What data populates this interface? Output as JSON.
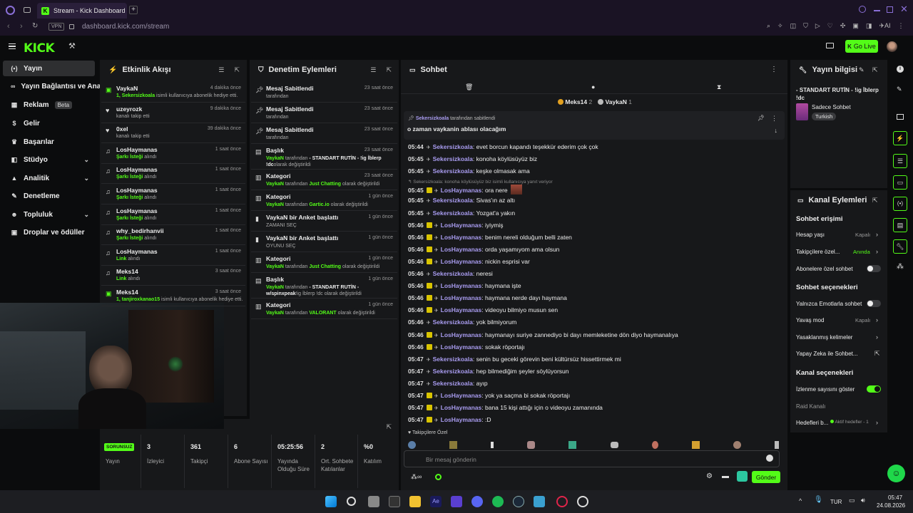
{
  "browser": {
    "tab_title": "Stream - Kick Dashboard",
    "vpn_label": "VPN",
    "url": "dashboard.kick.com/stream",
    "ai_label": "AI"
  },
  "header": {
    "logo": "KICK",
    "go_live": "Go Live"
  },
  "sidebar": {
    "items": [
      {
        "label": "Yayın",
        "icon": "broadcast-icon"
      },
      {
        "label": "Yayın Bağlantısı ve Anahtarı",
        "icon": "link-icon"
      },
      {
        "label": "Reklam",
        "icon": "ad-icon",
        "badge": "Beta"
      },
      {
        "label": "Gelir",
        "icon": "revenue-icon"
      },
      {
        "label": "Başarılar",
        "icon": "trophy-icon"
      },
      {
        "label": "Stüdyo",
        "icon": "studio-icon"
      },
      {
        "label": "Analitik",
        "icon": "analytics-icon"
      },
      {
        "label": "Denetleme",
        "icon": "moderation-icon"
      },
      {
        "label": "Topluluk",
        "icon": "community-icon"
      },
      {
        "label": "Droplar ve ödüller",
        "icon": "gift-icon"
      }
    ]
  },
  "activity": {
    "title": "Etkinlik Akışı",
    "items": [
      {
        "name": "VaykaN",
        "sub_hl": "1, Sekersizkoala",
        "sub": " isimli kullanıcıya abonelik hediye etti.",
        "time": "4 dakika önce"
      },
      {
        "name": "uzeyrozk",
        "sub_hl": "",
        "sub": "kanalı takip etti",
        "time": "9 dakika önce"
      },
      {
        "name": "0xel",
        "sub_hl": "",
        "sub": "kanalı takip etti",
        "time": "39 dakika önce"
      },
      {
        "name": "LosHaymanas",
        "sub_hl": "Şarkı İsteği",
        "sub": " alındı",
        "time": "1 saat önce"
      },
      {
        "name": "LosHaymanas",
        "sub_hl": "Şarkı İsteği",
        "sub": " alındı",
        "time": "1 saat önce"
      },
      {
        "name": "LosHaymanas",
        "sub_hl": "Şarkı İsteği",
        "sub": " alındı",
        "time": "1 saat önce"
      },
      {
        "name": "LosHaymanas",
        "sub_hl": "Şarkı İsteği",
        "sub": " alındı",
        "time": "1 saat önce"
      },
      {
        "name": "why_bedirhanvii",
        "sub_hl": "Şarkı İsteği",
        "sub": " alındı",
        "time": "1 saat önce"
      },
      {
        "name": "LosHaymanas",
        "sub_hl": "Link",
        "sub": " alındı",
        "time": "1 saat önce"
      },
      {
        "name": "Meks14",
        "sub_hl": "Link",
        "sub": " alındı",
        "time": "3 saat önce"
      },
      {
        "name": "Meks14",
        "sub_hl": "1, tanjiroxkanao15",
        "sub": " isimli kullanıcıya abonelik hediye etti.",
        "time": "3 saat önce"
      }
    ]
  },
  "moderation": {
    "title": "Denetim Eylemleri",
    "items": [
      {
        "name": "Mesaj Sabitlendi",
        "user": "",
        "sub": "tarafından",
        "hl": "",
        "after": "",
        "time": "23 saat önce",
        "icon": "pin-icon"
      },
      {
        "name": "Mesaj Sabitlendi",
        "user": "",
        "sub": "tarafından",
        "hl": "",
        "after": "",
        "time": "23 saat önce",
        "icon": "pin-icon"
      },
      {
        "name": "Mesaj Sabitlendi",
        "user": "",
        "sub": "tarafından",
        "hl": "",
        "after": "",
        "time": "23 saat önce",
        "icon": "pin-icon"
      },
      {
        "name": "Başlık",
        "user": "VaykaN",
        "sub": " tarafından",
        "hl": " - STANDART RUTİN - !ig İblerp !dc",
        "after": "olarak değiştirildi",
        "time": "23 saat önce",
        "icon": "title-icon"
      },
      {
        "name": "Kategori",
        "user": "VaykaN",
        "sub": " tarafından",
        "hl": " Just Chatting",
        "after": " olarak değiştirildi",
        "time": "23 saat önce",
        "icon": "category-icon"
      },
      {
        "name": "Kategori",
        "user": "VaykaN",
        "sub": " tarafından",
        "hl": " Gartic.io",
        "after": " olarak değiştirildi",
        "time": "1 gün önce",
        "icon": "category-icon"
      },
      {
        "name": "VaykaN bir Anket başlattı",
        "user": "",
        "sub": "ZAMANI SEÇ",
        "hl": "",
        "after": "",
        "time": "1 gün önce",
        "icon": "poll-icon"
      },
      {
        "name": "VaykaN bir Anket başlattı",
        "user": "",
        "sub": "OYUNU SEÇ",
        "hl": "",
        "after": "",
        "time": "1 gün önce",
        "icon": "poll-icon"
      },
      {
        "name": "Kategori",
        "user": "VaykaN",
        "sub": " tarafından",
        "hl": " Just Chatting",
        "after": " olarak değiştirildi",
        "time": "1 gün önce",
        "icon": "category-icon"
      },
      {
        "name": "Başlık",
        "user": "VaykaN",
        "sub": " tarafından",
        "hl": " - STANDART RUTİN - w/spinxpeak",
        "after": "!ig İblerp !dc olarak değiştirildi",
        "time": "1 gün önce",
        "icon": "title-icon"
      },
      {
        "name": "Kategori",
        "user": "VaykaN",
        "sub": " tarafından",
        "hl": " VALORANT",
        "after": " olarak değiştirildi",
        "time": "1 gün önce",
        "icon": "category-icon"
      }
    ]
  },
  "chat": {
    "title": "Sohbet",
    "top_users": [
      {
        "name": "Meks14",
        "count": "2"
      },
      {
        "name": "VaykaN",
        "count": "1"
      }
    ],
    "pinned_by": "Sekersizkoala",
    "pinned_by_suffix": " tarafından sabitlendi",
    "pinned_text": "o zaman vaykanin ablası olacağım",
    "reply_hint": "Sekersizkoala: konoha köylüsüyüz biz isimli kullanıcıya yanıt veriyor",
    "messages": [
      {
        "t": "05:44",
        "u": "Sekersizkoala",
        "m": "evet borcun kapandı teşekkür ederim çok çok",
        "badge": false
      },
      {
        "t": "05:45",
        "u": "Sekersizkoala",
        "m": "konoha köylüsüyüz biz",
        "badge": false
      },
      {
        "t": "05:45",
        "u": "Sekersizkoala",
        "m": "keşke olmasak ama",
        "badge": false
      },
      {
        "t": "05:45",
        "u": "LosHaymanas",
        "m": "ora nere",
        "badge": true
      },
      {
        "t": "05:45",
        "u": "Sekersizkoala",
        "m": "Sivas'ın az altı",
        "badge": false
      },
      {
        "t": "05:45",
        "u": "Sekersizkoala",
        "m": "Yozgat'a yakın",
        "badge": false
      },
      {
        "t": "05:46",
        "u": "LosHaymanas",
        "m": "iyiymiş",
        "badge": true
      },
      {
        "t": "05:46",
        "u": "LosHaymanas",
        "m": "benim nereli olduğum belli zaten",
        "badge": true
      },
      {
        "t": "05:46",
        "u": "LosHaymanas",
        "m": "orda yaşamıyom ama olsun",
        "badge": true
      },
      {
        "t": "05:46",
        "u": "LosHaymanas",
        "m": "nickin esprisi var",
        "badge": true
      },
      {
        "t": "05:46",
        "u": "Sekersizkoala",
        "m": "neresi",
        "badge": false
      },
      {
        "t": "05:46",
        "u": "LosHaymanas",
        "m": "haymana işte",
        "badge": true
      },
      {
        "t": "05:46",
        "u": "LosHaymanas",
        "m": "haymana nerde dayı haymana",
        "badge": true
      },
      {
        "t": "05:46",
        "u": "LosHaymanas",
        "m": "videoyu bilmiyo musun sen",
        "badge": true
      },
      {
        "t": "05:46",
        "u": "Sekersizkoala",
        "m": "yok bilmiyorum",
        "badge": false
      },
      {
        "t": "05:46",
        "u": "LosHaymanas",
        "m": "haymanayı suriye zannediyo bi dayı memleketine dön diyo haymanalıya",
        "badge": true
      },
      {
        "t": "05:46",
        "u": "LosHaymanas",
        "m": "sokak röportajı",
        "badge": true
      },
      {
        "t": "05:47",
        "u": "Sekersizkoala",
        "m": "senin bu geceki görevin beni kültürsüz hissettirmek mi",
        "badge": false
      },
      {
        "t": "05:47",
        "u": "Sekersizkoala",
        "m": "hep bilmediğim şeyler söylüyorsun",
        "badge": false
      },
      {
        "t": "05:47",
        "u": "Sekersizkoala",
        "m": "ayıp",
        "badge": false
      },
      {
        "t": "05:47",
        "u": "LosHaymanas",
        "m": "yok ya saçma bi sokak röportajı",
        "badge": true
      },
      {
        "t": "05:47",
        "u": "LosHaymanas",
        "m": "bana 15 kişi attığı için o videoyu zamanında",
        "badge": true
      },
      {
        "t": "05:47",
        "u": "LosHaymanas",
        "m": ":D",
        "badge": true
      }
    ],
    "followers_only": "Takipçilere Özel",
    "input_placeholder": "Bir mesaj gönderin",
    "send": "Gönder"
  },
  "stream_info": {
    "title": "Yayın bilgisi",
    "stream_title": "- STANDART RUTİN - !ig İblerp !dc",
    "category": "Sadece Sohbet",
    "language": "Turkish"
  },
  "channel_actions": {
    "title": "Kanal Eylemleri",
    "chat_access": "Sohbet erişimi",
    "account_age": "Hesap yaşı",
    "account_age_value": "Kapalı",
    "followers_only": "Takipçilere özel...",
    "followers_only_value": "Anında",
    "subs_only": "Abonelere özel sohbet",
    "chat_options": "Sohbet seçenekleri",
    "emotes_only": "Yalnızca Emotlarla sohbet",
    "slow_mode": "Yavaş mod",
    "slow_mode_value": "Kapalı",
    "banned_words": "Yasaklanmış kelimeler",
    "ai_chat": "Yapay Zeka ile Sohbet...",
    "channel_options": "Kanal seçenekleri",
    "show_viewers": "İzlenme sayısını göster",
    "raid": "Raid Kanalı",
    "goals": "Hedefleri b...",
    "goals_value": "Aktif hedefler - 1"
  },
  "stats": [
    {
      "value": "SORUNSUZ",
      "label": "Yayın",
      "pill": true
    },
    {
      "value": "3",
      "label": "İzleyici"
    },
    {
      "value": "361",
      "label": "Takipçi"
    },
    {
      "value": "6",
      "label": "Abone Sayısı"
    },
    {
      "value": "05:25:56",
      "label": "Yayında Olduğu Süre"
    },
    {
      "value": "2",
      "label": "Ort. Sohbete Katılanlar"
    },
    {
      "value": "%0",
      "label": "Katılım"
    }
  ],
  "taskbar": {
    "lang": "TUR",
    "time": "05:47",
    "date": "24.08.2026"
  },
  "colors": {
    "accent": "#53fc18",
    "panel": "#17181a",
    "username": "#a99cf0"
  }
}
